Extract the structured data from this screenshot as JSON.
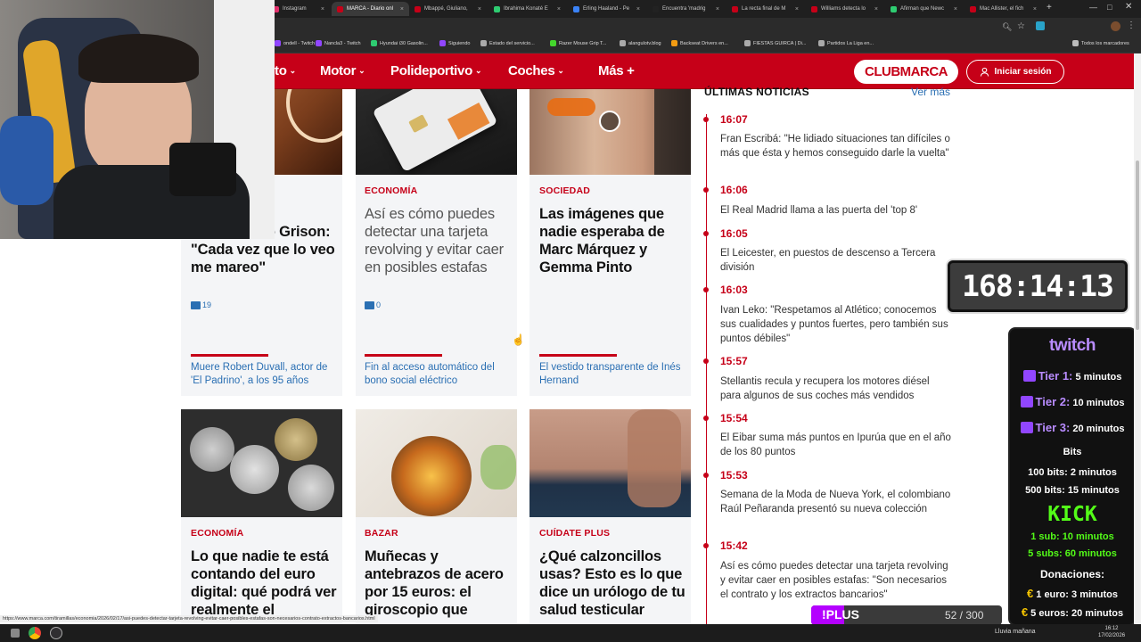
{
  "browser": {
    "tabs": [
      {
        "label": "Instagram",
        "color": "#e1306c"
      },
      {
        "label": "MARCA - Diario onl",
        "color": "#c60018",
        "active": true
      },
      {
        "label": "Mbappé, Giuliano,",
        "color": "#c60018"
      },
      {
        "label": "Ibrahima Konaté E",
        "color": "#2ecc71"
      },
      {
        "label": "Erling Haaland - Pe",
        "color": "#3b82f6"
      },
      {
        "label": "Encuentra 'madrig",
        "color": "#222222"
      },
      {
        "label": "La recta final de M",
        "color": "#c60018"
      },
      {
        "label": "Williams detecta lo",
        "color": "#c60018"
      },
      {
        "label": "Afirman que Newc",
        "color": "#2ecc71"
      },
      {
        "label": "Mac Allister, el fich",
        "color": "#c60018"
      }
    ],
    "bookmarks": [
      {
        "label": "ondell - Twitch",
        "color": "#9146ff"
      },
      {
        "label": "Nancla3 - Twitch",
        "color": "#9146ff"
      },
      {
        "label": "Hyundai i30 Gasolin...",
        "color": "#2ecc71"
      },
      {
        "label": "Siguiendo",
        "color": "#9146ff"
      },
      {
        "label": "Estado del servicio...",
        "color": "#aaaaaa"
      },
      {
        "label": "Razer Mouse Grip T...",
        "color": "#44d62c"
      },
      {
        "label": "alangulotv.blog",
        "color": "#aaaaaa"
      },
      {
        "label": "Backseat Drivers en...",
        "color": "#f39c12"
      },
      {
        "label": "FIESTAS GUIRCA | Di...",
        "color": "#aaaaaa"
      },
      {
        "label": "Partidos La Liga en...",
        "color": "#aaaaaa"
      }
    ],
    "all_bookmarks": "Todos los marcadores",
    "status_url": "https://www.marca.com/tiramillas/economia/2026/02/17/asi-puedes-detectar-tarjeta-revolving-evitar-caer-posibles-estafas-son-necesarios-contrato-extractos-bancarios.html"
  },
  "nav": {
    "items": [
      {
        "label": "to",
        "chevron": true
      },
      {
        "label": "Motor",
        "chevron": true
      },
      {
        "label": "Polideportivo",
        "chevron": true
      },
      {
        "label": "Coches",
        "chevron": true
      },
      {
        "label": "Más",
        "plus": "+"
      }
    ],
    "club": "CLUBMARCA",
    "login": "Iniciar sesión"
  },
  "cards_row1": [
    {
      "section": "",
      "headline": "ue ha tenido Grison: \"Cada vez que lo veo me mareo\"",
      "comments": "19",
      "related": "Muere Robert Duvall, actor de 'El Padrino', a los 95 años"
    },
    {
      "section": "ECONOMÍA",
      "headline": "Así es cómo puedes detectar una tarjeta revolving y evitar caer en posibles estafas",
      "comments": "0",
      "related": "Fin al acceso automático del bono social eléctrico"
    },
    {
      "section": "SOCIEDAD",
      "headline": "Las imágenes que nadie esperaba de Marc Márquez y Gemma Pinto",
      "related": "El vestido transparente de Inés Hernand"
    }
  ],
  "cards_row2": [
    {
      "section": "ECONOMÍA",
      "headline": "Lo que nadie te está contando del euro digital: qué podrá ver realmente el"
    },
    {
      "section": "BAZAR",
      "headline": "Muñecas y antebrazos de acero por 15 euros: el giroscopio que"
    },
    {
      "section": "CUÍDATE PLUS",
      "headline": "¿Qué calzoncillos usas? Esto es lo que dice un urólogo de tu salud testicular"
    }
  ],
  "news": {
    "title": "ÚLTIMAS NOTICIAS",
    "more": "Ver más",
    "items": [
      {
        "time": "16:07",
        "text": "Fran Escribá: \"He lidiado situaciones tan difíciles o más que ésta y hemos conseguido darle la vuelta\""
      },
      {
        "time": "16:06",
        "text": "El Real Madrid llama a las puerta del 'top 8'"
      },
      {
        "time": "16:05",
        "text": "El Leicester, en puestos de descenso a Tercera división"
      },
      {
        "time": "16:03",
        "text": "Ivan Leko: \"Respetamos al Atlético; conocemos sus cualidades y puntos fuertes, pero también sus puntos débiles\""
      },
      {
        "time": "15:57",
        "text": "Stellantis recula y recupera los motores diésel para algunos de sus coches más vendidos"
      },
      {
        "time": "15:54",
        "text": "El Eibar suma más puntos en Ipurúa que en el año de los 80 puntos"
      },
      {
        "time": "15:53",
        "text": "Semana de la Moda de Nueva York, el colombiano Raúl Peñaranda presentó su nueva colección"
      },
      {
        "time": "15:42",
        "text": "Así es cómo puedes detectar una tarjeta revolving y evitar caer en posibles estafas: \"Son necesarios el contrato y los extractos bancarios\""
      }
    ]
  },
  "overlay": {
    "timer": "168:14:13",
    "panel": {
      "twitch_logo": "twitch",
      "tiers": [
        {
          "label": "Tier 1:",
          "value": "5 minutos"
        },
        {
          "label": "Tier 2:",
          "value": "10 minutos"
        },
        {
          "label": "Tier 3:",
          "value": "20 minutos"
        }
      ],
      "bits_title": "Bits",
      "bits": [
        {
          "label": "100 bits:",
          "value": "2 minutos"
        },
        {
          "label": "500 bits:",
          "value": "15 minutos"
        }
      ],
      "kick_logo": "KICK",
      "kick": [
        {
          "label": "1 sub:",
          "value": "10 minutos"
        },
        {
          "label": "5 subs:",
          "value": "60 minutos"
        }
      ],
      "donations_title": "Donaciones:",
      "donations": [
        {
          "label": "1 euro:",
          "value": "3 minutos"
        },
        {
          "label": "5 euros:",
          "value": "20 minutos"
        }
      ]
    },
    "plus": {
      "label": "!PLUS",
      "count": "52 / 300",
      "progress": 0.173
    }
  },
  "taskbar": {
    "weather": "Lluvia mañana",
    "time": "16:12",
    "date": "17/02/2026"
  }
}
